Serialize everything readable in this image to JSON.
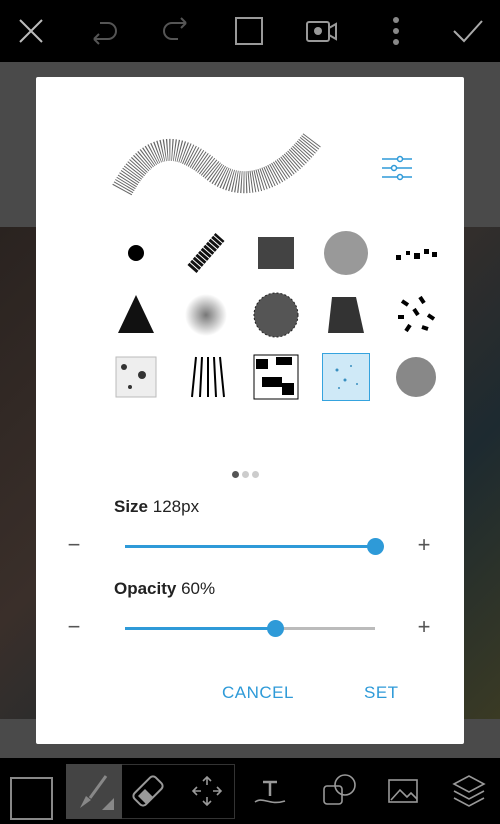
{
  "toolbar": {
    "icons": [
      "close-icon",
      "undo-icon",
      "redo-icon",
      "fullscreen-icon",
      "record-video-icon",
      "more-icon",
      "check-icon"
    ]
  },
  "dialog": {
    "brushes": [
      "round-solid",
      "charcoal-stroke",
      "rough-square",
      "noise-circle",
      "scatter-squares",
      "spray-triangle",
      "soft-round",
      "speckle-circle",
      "rough-blob",
      "scatter-dashes",
      "grunge-square",
      "hair-lines",
      "splatter-square",
      "sparkle-square",
      "soft-noise-circle"
    ],
    "selected_brush": 13,
    "page": 1,
    "pages": 3,
    "size": {
      "label": "Size",
      "value": "128px",
      "fraction": 1.0
    },
    "opacity": {
      "label": "Opacity",
      "value": "60%",
      "fraction": 0.6
    },
    "cancel": "CANCEL",
    "set": "SET",
    "accent": "#2e9ad8"
  },
  "bottom": {
    "icons": [
      "color-swatch",
      "brush-icon",
      "eraser-icon",
      "move-icon",
      "text-icon",
      "shape-icon",
      "add-photo-icon",
      "layers-icon"
    ]
  }
}
